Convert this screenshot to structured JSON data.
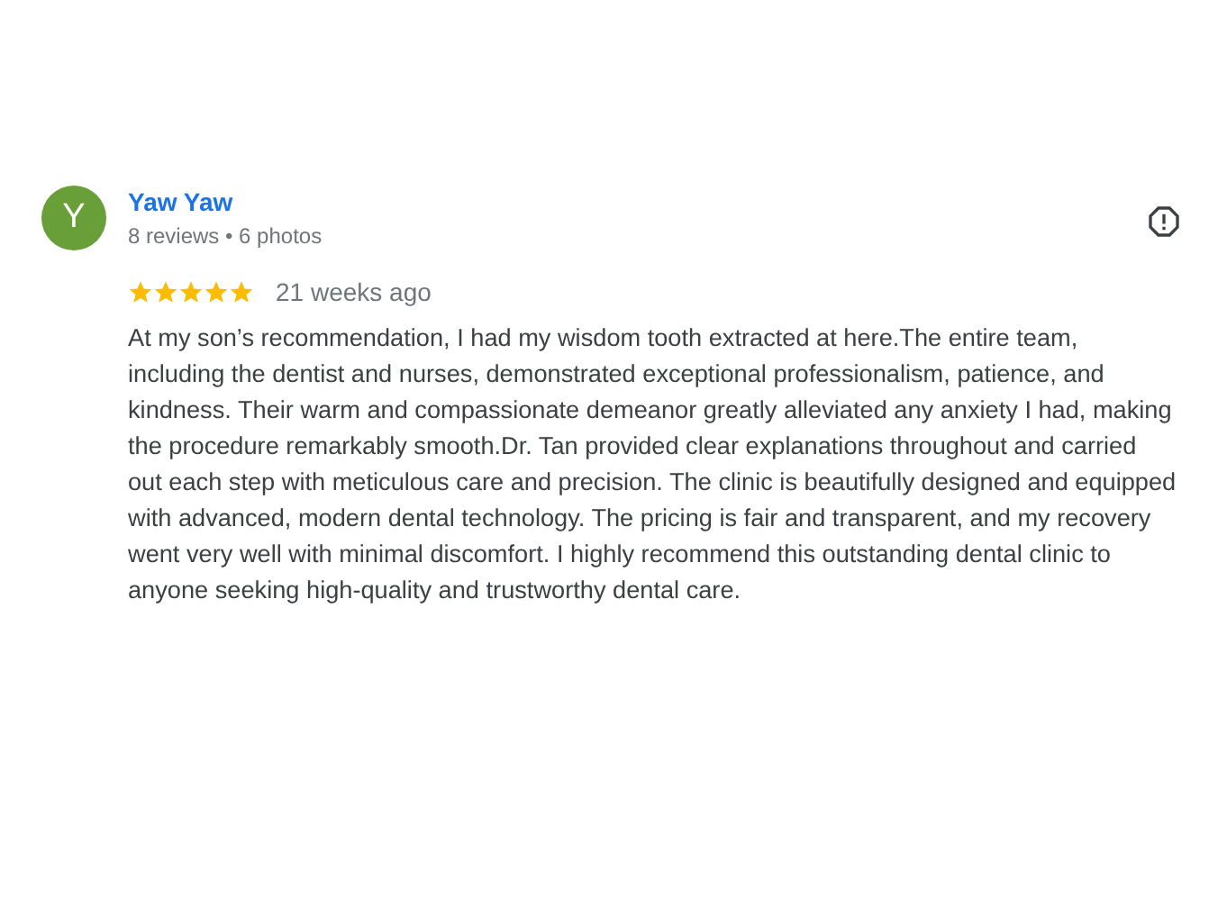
{
  "review": {
    "avatar_letter": "Y",
    "author": "Yaw Yaw",
    "meta": "8 reviews • 6 photos",
    "stars": 5,
    "time": "21 weeks ago",
    "text": "At my son’s recommendation, I had my wisdom tooth extracted at here.The entire team, including the dentist and nurses, demonstrated exceptional professionalism, patience, and kindness. Their warm and compassionate demeanor greatly alleviated any anxiety I had, making the procedure remarkably smooth.Dr. Tan provided clear explanations throughout and carried out each step with meticulous care and precision. The clinic is beautifully designed and equipped with advanced, modern dental technology. The pricing is fair and transparent, and my recovery went very well with minimal discomfort. I highly recommend this outstanding dental clinic to anyone seeking high-quality and trustworthy dental care."
  }
}
